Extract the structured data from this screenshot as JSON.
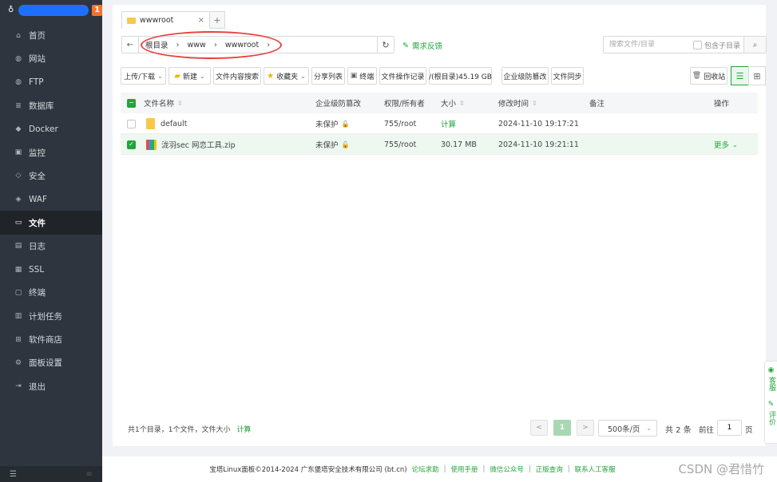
{
  "sidebar": {
    "badge": "1",
    "items": [
      {
        "label": "首页",
        "icon": "home-icon",
        "glyph": "⌂"
      },
      {
        "label": "网站",
        "icon": "globe-icon",
        "glyph": "◍"
      },
      {
        "label": "FTP",
        "icon": "ftp-globe-icon",
        "glyph": "◍"
      },
      {
        "label": "数据库",
        "icon": "database-icon",
        "glyph": "≣"
      },
      {
        "label": "Docker",
        "icon": "docker-icon",
        "glyph": "◆"
      },
      {
        "label": "监控",
        "icon": "monitor-icon",
        "glyph": "▣"
      },
      {
        "label": "安全",
        "icon": "security-icon",
        "glyph": "◇"
      },
      {
        "label": "WAF",
        "icon": "shield-icon",
        "glyph": "◈"
      },
      {
        "label": "文件",
        "icon": "folder-icon",
        "glyph": "▭"
      },
      {
        "label": "日志",
        "icon": "log-icon",
        "glyph": "▤"
      },
      {
        "label": "SSL",
        "icon": "ssl-icon",
        "glyph": "▦"
      },
      {
        "label": "终端",
        "icon": "terminal-icon",
        "glyph": "▢"
      },
      {
        "label": "计划任务",
        "icon": "cron-icon",
        "glyph": "▥"
      },
      {
        "label": "软件商店",
        "icon": "store-icon",
        "glyph": "⊞"
      },
      {
        "label": "面板设置",
        "icon": "settings-icon",
        "glyph": "⚙"
      },
      {
        "label": "退出",
        "icon": "logout-icon",
        "glyph": "⇥"
      }
    ],
    "active_index": 8
  },
  "tab": {
    "label": "wwwroot",
    "close": "×",
    "add": "+"
  },
  "path": {
    "crumbs": [
      "根目录",
      "www",
      "wwwroot"
    ],
    "feedback": "需求反馈"
  },
  "search": {
    "placeholder": "搜索文件/目录",
    "include_sub": "包含子目录"
  },
  "toolbar": {
    "upload": "上传/下载",
    "new": "新建",
    "content_search": "文件内容搜索",
    "favorites": "收藏夹",
    "share_list": "分享列表",
    "terminal": "终端",
    "op_log": "文件操作记录",
    "disk": "/(根目录)45.19 GB",
    "tamper": "企业级防篡改",
    "sync": "文件同步",
    "recycle": "回收站"
  },
  "table": {
    "headers": {
      "name": "文件名称",
      "tamper": "企业级防篡改",
      "perm": "权限/所有者",
      "size": "大小",
      "mtime": "修改时间",
      "note": "备注",
      "ops": "操作"
    },
    "rows": [
      {
        "name": "default",
        "tamper": "未保护",
        "perm": "755/root",
        "size": "计算",
        "mtime": "2024-11-10 19:17:21",
        "ops": ""
      },
      {
        "name": "泷羽sec 网恋工具.zip",
        "tamper": "未保护",
        "perm": "755/root",
        "size": "30.17 MB",
        "mtime": "2024-11-10 19:21:11",
        "ops": "更多"
      }
    ]
  },
  "summary": {
    "text": "共1个目录，1个文件，文件大小",
    "calc": "计算"
  },
  "pager": {
    "prev": "<",
    "current": "1",
    "next": ">",
    "per_page": "500条/页",
    "total": "共 2 条",
    "goto": "前往",
    "goto_value": "1",
    "page_suffix": "页"
  },
  "footer": {
    "copyright": "宝塔Linux面板©2014-2024 广东堡塔安全技术有限公司 (bt.cn)",
    "links": [
      "论坛求助",
      "使用手册",
      "微信公众号",
      "正版查询",
      "联系人工客服"
    ]
  },
  "float": {
    "service": "客服",
    "review": "评价"
  },
  "watermark": "CSDN @君惜竹",
  "colors": {
    "accent": "#20a53a",
    "sidebar": "#2f353e",
    "annotation": "#e8413e"
  }
}
